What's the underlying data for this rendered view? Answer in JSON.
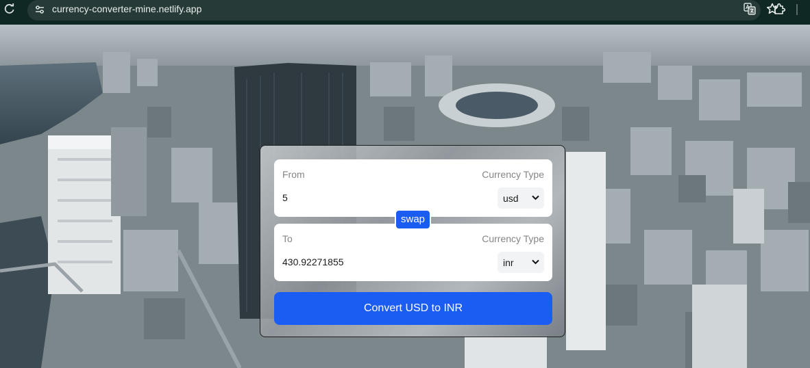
{
  "browser": {
    "url": "currency-converter-mine.netlify.app"
  },
  "converter": {
    "from": {
      "label": "From",
      "amount": "5",
      "type_label": "Currency Type",
      "currency": "usd"
    },
    "to": {
      "label": "To",
      "amount": "430.92271855",
      "type_label": "Currency Type",
      "currency": "inr"
    },
    "swap_label": "swap",
    "convert_label": "Convert USD to INR"
  },
  "colors": {
    "accent": "#1b5cf2",
    "chrome_bg": "#0f2824"
  }
}
